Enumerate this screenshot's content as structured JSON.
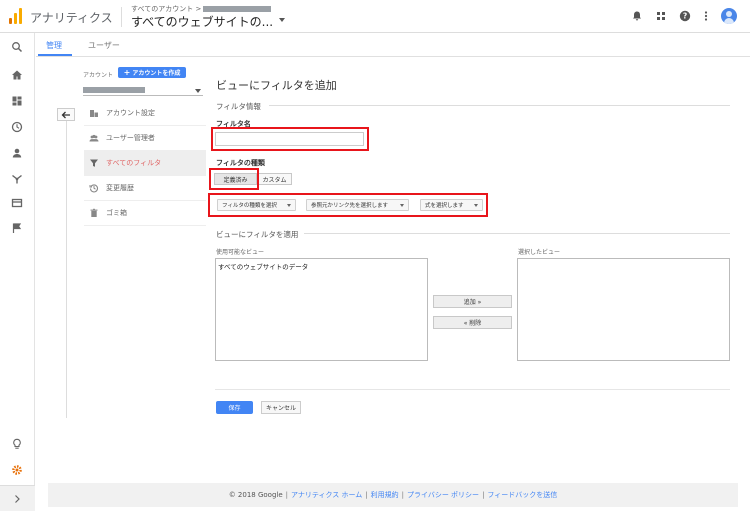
{
  "header": {
    "app_name": "アナリティクス",
    "breadcrumb": "すべてのアカウント >",
    "property_title": "すべてのウェブサイトの..."
  },
  "tabs": [
    {
      "label": "管理"
    },
    {
      "label": "ユーザー"
    }
  ],
  "account": {
    "label": "アカウント",
    "create_button": "アカウントを作成",
    "create_button_icon": "+"
  },
  "menu": [
    {
      "label": "アカウント設定",
      "icon": "building-icon"
    },
    {
      "label": "ユーザー管理者",
      "icon": "people-icon"
    },
    {
      "label": "すべてのフィルタ",
      "icon": "filter-icon",
      "active": true
    },
    {
      "label": "変更履歴",
      "icon": "history-icon"
    },
    {
      "label": "ゴミ箱",
      "icon": "trash-icon"
    }
  ],
  "form": {
    "title": "ビューにフィルタを追加",
    "section_info": "フィルタ情報",
    "name_label": "フィルタ名",
    "name_value": "",
    "type_label": "フィルタの種類",
    "type_options": [
      "定義済み",
      "カスタム"
    ],
    "type_selected": "定義済み",
    "dropdowns": [
      "フィルタの種類を選択",
      "参照元かリンク先を選択します",
      "式を選択します"
    ],
    "section_apply": "ビューにフィルタを適用",
    "available_label": "使用可能なビュー",
    "available_views": [
      "すべてのウェブサイトのデータ"
    ],
    "selected_label": "選択したビュー",
    "selected_views": [],
    "add_button": "追加 »",
    "remove_button": "« 削除",
    "save_button": "保存",
    "cancel_button": "キャンセル"
  },
  "footer": {
    "copyright": "© 2018 Google",
    "links": [
      "アナリティクス ホーム",
      "利用規約",
      "プライバシー ポリシー",
      "フィードバックを送信"
    ],
    "separator": "|"
  },
  "colors": {
    "accent": "#4285f4",
    "highlight": "#e8151b",
    "active_menu": "#e06666",
    "logo_orange": "#f9ab00",
    "settings_icon": "#e8710a"
  }
}
